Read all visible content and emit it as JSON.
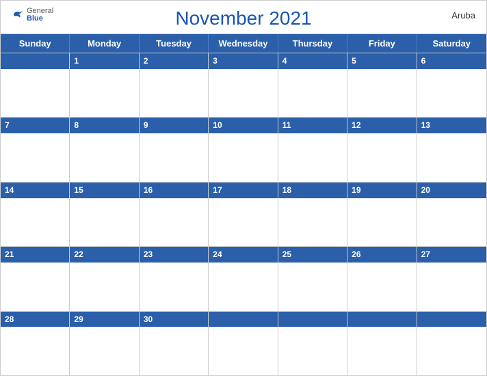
{
  "header": {
    "title": "November 2021",
    "country": "Aruba",
    "logo": {
      "general": "General",
      "blue": "Blue"
    }
  },
  "days_of_week": [
    "Sunday",
    "Monday",
    "Tuesday",
    "Wednesday",
    "Thursday",
    "Friday",
    "Saturday"
  ],
  "weeks": [
    [
      null,
      1,
      2,
      3,
      4,
      5,
      6
    ],
    [
      7,
      8,
      9,
      10,
      11,
      12,
      13
    ],
    [
      14,
      15,
      16,
      17,
      18,
      19,
      20
    ],
    [
      21,
      22,
      23,
      24,
      25,
      26,
      27
    ],
    [
      28,
      29,
      30,
      null,
      null,
      null,
      null
    ]
  ],
  "colors": {
    "blue": "#2b5faa",
    "white": "#ffffff"
  }
}
